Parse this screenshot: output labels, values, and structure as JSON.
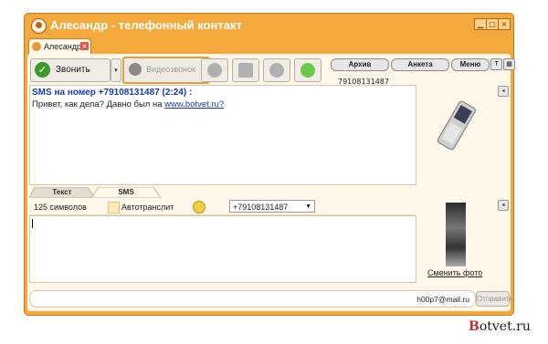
{
  "window": {
    "title": "Алесандр - телефонный контакт"
  },
  "contact_tab": {
    "label": "Алесандр"
  },
  "toolbar": {
    "call_label": "Звонить",
    "video_label": "Видеозвонок",
    "archive_label": "Архив",
    "profile_label": "Анкета",
    "menu_label": "Меню"
  },
  "chat": {
    "phone_label": "79108131487",
    "header": "SMS на номер +79108131487 (2:24) :",
    "message_text": "Привет, как дела? Давно был на",
    "message_link": "www.botvet.ru?"
  },
  "composer": {
    "tabs": [
      "Текст",
      "SMS"
    ],
    "active_tab": "SMS",
    "char_count": "125 символов",
    "translit_label": "Автотранслит",
    "phone_select": "+79108131487"
  },
  "photo": {
    "change_label": "Сменить фото"
  },
  "status": {
    "email": "h00p7@mail.ru",
    "send_label": "Отправить"
  },
  "watermark": {
    "prefix": "B",
    "rest": "otvet.ru"
  },
  "colors": {
    "window": "#f4a93c",
    "accent_link": "#1a3bb0"
  }
}
